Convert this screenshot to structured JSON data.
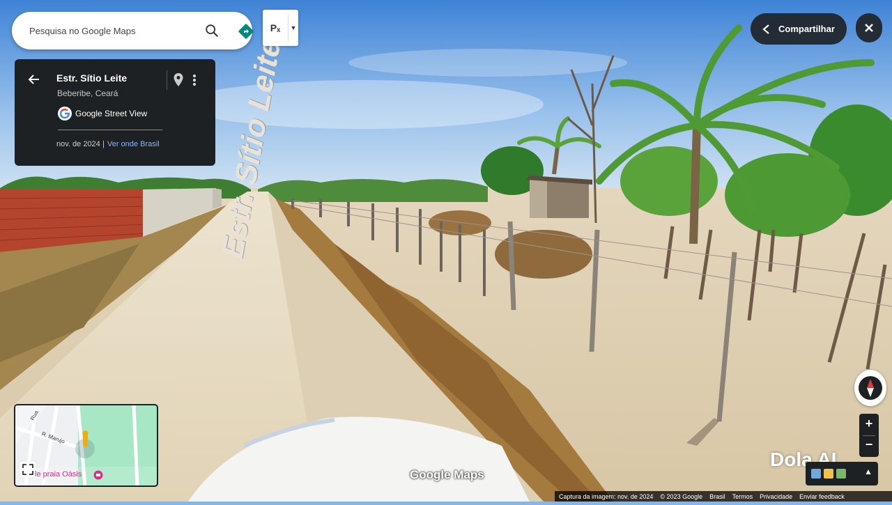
{
  "search": {
    "placeholder": "Pesquisa no Google Maps"
  },
  "layers": {
    "label": "Pₓ"
  },
  "info_card": {
    "title": "Estr. Sítio Leite",
    "subtitle": "Beberibe, Ceará",
    "brand": "Google Street View",
    "date": "nov. de 2024",
    "separator": "|",
    "link": "Ver onde Brasil"
  },
  "share": {
    "label": "Compartilhar"
  },
  "road_label": "Estr. Sítio Leite",
  "minimap": {
    "street_labels": [
      "Rua",
      "R. Marujo"
    ],
    "place_label": "le praia Oásis"
  },
  "branding": {
    "google_maps": "Google Maps",
    "watermark": "Dola AI"
  },
  "footer": {
    "items": [
      "Captura da imagem: nov. de 2024",
      "© 2023 Google",
      "Brasil",
      "Termos",
      "Privacidade",
      "Enviar feedback"
    ]
  },
  "colors": {
    "accent": "#1a73e8",
    "dark_panel": "#1e2124",
    "link": "#8ab4f8",
    "directions": "#00897b"
  }
}
